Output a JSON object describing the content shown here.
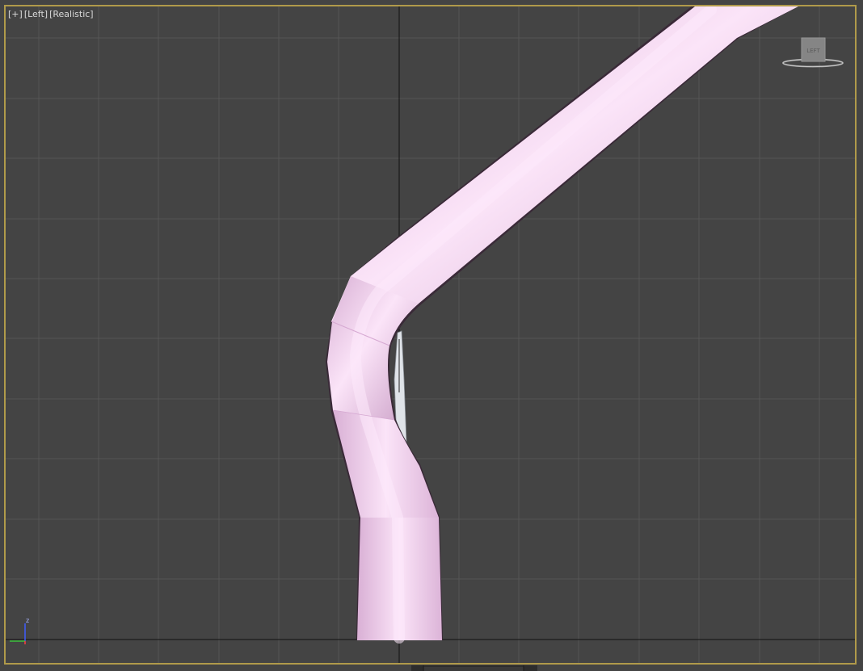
{
  "viewport": {
    "labels": [
      "[+]",
      "[Left]",
      "[Realistic]"
    ],
    "viewcube_face": "LEFT",
    "axis_label_z": "z",
    "colors": {
      "background": "#444444",
      "grid_line": "#5a5a5a",
      "grid_axis": "#000000",
      "frame_border": "#b09a4a",
      "tube_fill": "#f0c8ec",
      "tube_highlight": "#fbe4f8",
      "tube_shadow": "#c89cc4",
      "tube_edge": "#3a2a38",
      "inner_object": "#dfe3e8",
      "axis_z": "#3e5cff",
      "axis_y": "#3cc03c"
    },
    "icons": {
      "viewcube": "viewcube-icon",
      "axis_tripod": "axis-tripod-icon"
    }
  }
}
